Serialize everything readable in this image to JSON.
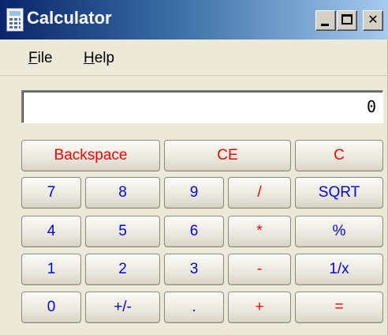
{
  "window": {
    "title": "Calculator"
  },
  "menu": {
    "file": "File",
    "help": "Help"
  },
  "display": {
    "value": "0"
  },
  "keys": {
    "backspace": "Backspace",
    "ce": "CE",
    "c": "C",
    "seven": "7",
    "eight": "8",
    "nine": "9",
    "divide": "/",
    "sqrt": "SQRT",
    "four": "4",
    "five": "5",
    "six": "6",
    "multiply": "*",
    "percent": "%",
    "one": "1",
    "two": "2",
    "three": "3",
    "minus": "-",
    "reciprocal": "1/x",
    "zero": "0",
    "plus_minus": "+/-",
    "decimal": ".",
    "plus": "+",
    "equals": "="
  },
  "colors": {
    "function_key_text": "#ff0000",
    "digit_key_text": "#0000ff",
    "window_background": "#ece9d8"
  }
}
